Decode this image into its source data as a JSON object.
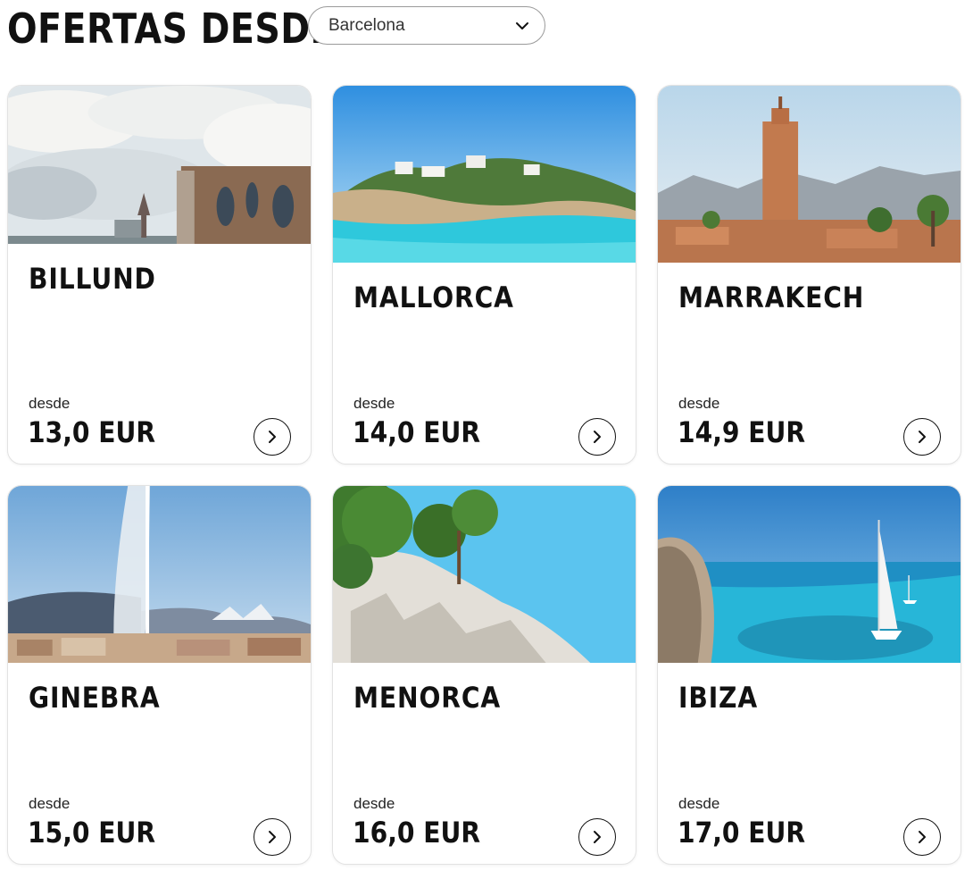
{
  "header": {
    "title": "OFERTAS DESDE",
    "origin_select": {
      "value": "Barcelona",
      "icon": "chevron-down-icon"
    }
  },
  "cards": [
    {
      "destination": "BILLUND",
      "from_label": "desde",
      "price": "13,0 EUR",
      "image": "billund-building-clouds"
    },
    {
      "destination": "MALLORCA",
      "from_label": "desde",
      "price": "14,0 EUR",
      "image": "mallorca-cove"
    },
    {
      "destination": "MARRAKECH",
      "from_label": "desde",
      "price": "14,9 EUR",
      "image": "marrakech-minaret"
    },
    {
      "destination": "GINEBRA",
      "from_label": "desde",
      "price": "15,0 EUR",
      "image": "geneva-fountain"
    },
    {
      "destination": "MENORCA",
      "from_label": "desde",
      "price": "16,0 EUR",
      "image": "menorca-cliff-pines"
    },
    {
      "destination": "IBIZA",
      "from_label": "desde",
      "price": "17,0 EUR",
      "image": "ibiza-sailboat"
    }
  ],
  "colors": {
    "text": "#111111",
    "border": "#e2e2e2",
    "sea": "#2ec8dc",
    "sky": "#5bb8ea"
  }
}
